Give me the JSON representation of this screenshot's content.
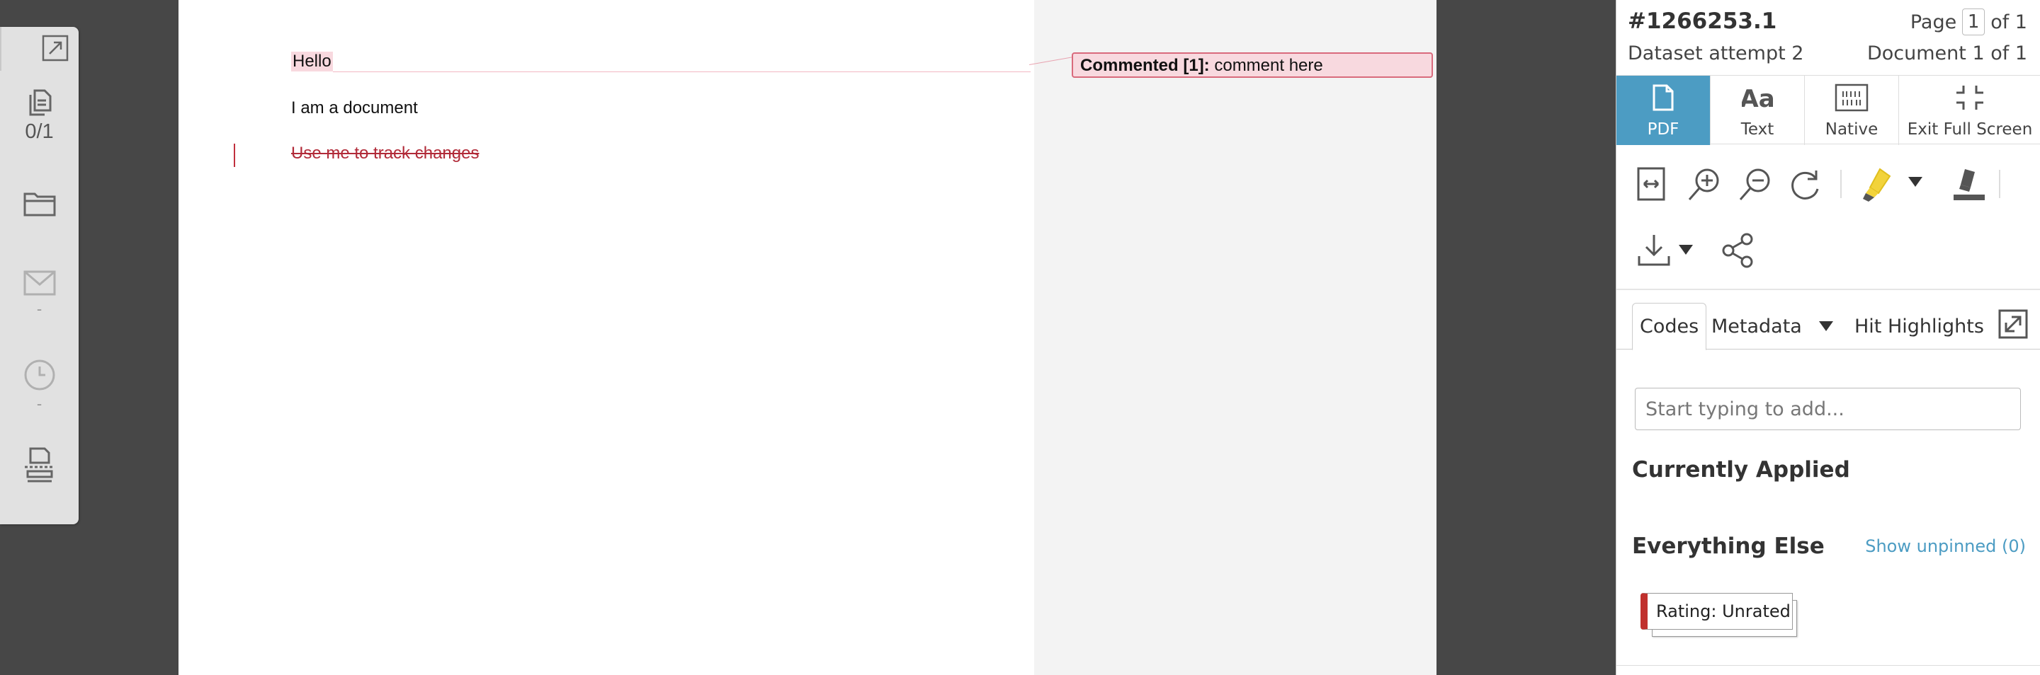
{
  "left_toolbar": {
    "document_counter": "0/1",
    "email_dash": "-",
    "history_dash": "-",
    "icons": [
      "expand-icon",
      "copy-documents-icon",
      "folder-icon",
      "envelope-icon",
      "clock-icon",
      "print-icon"
    ]
  },
  "document": {
    "lines": {
      "hello": "Hello",
      "body": "I am a document",
      "tracked_change": "Use me to track changes"
    },
    "comment": {
      "label": "Commented [1]:",
      "text": " comment here"
    },
    "colors": {
      "comment_fill": "#f8d9df",
      "comment_border": "#d96a7c",
      "tracked_change": "#b12a38"
    }
  },
  "header": {
    "doc_id": "#1266253.1",
    "dataset": "Dataset attempt 2",
    "page_prefix": "Page",
    "page_current": "1",
    "page_suffix": "of 1",
    "document_count": "Document 1 of 1"
  },
  "view_tabs": [
    {
      "label": "PDF",
      "icon": "pdf-file-icon",
      "active": true
    },
    {
      "label": "Text",
      "icon": "text-aa-icon",
      "active": false
    },
    {
      "label": "Native",
      "icon": "binary-file-icon",
      "active": false
    },
    {
      "label": "Exit Full Screen",
      "icon": "exit-fullscreen-icon",
      "active": false
    }
  ],
  "tools": [
    "fit-width-icon",
    "zoom-in-icon",
    "zoom-out-icon",
    "rotate-icon",
    "highlighter-icon",
    "redaction-marker-icon",
    "download-icon",
    "share-icon"
  ],
  "sub_tabs": {
    "codes": "Codes",
    "metadata": "Metadata",
    "hit_highlights": "Hit Highlights"
  },
  "codes": {
    "input_placeholder": "Start typing to add...",
    "currently_applied": "Currently Applied",
    "everything_else": "Everything Else",
    "show_unpinned": "Show unpinned (0)",
    "rating_chip": "Rating: Unrated"
  },
  "colors": {
    "accent": "#4c9cc3",
    "rating_flag": "#c0302d",
    "highlighter": "#f2d33b"
  }
}
